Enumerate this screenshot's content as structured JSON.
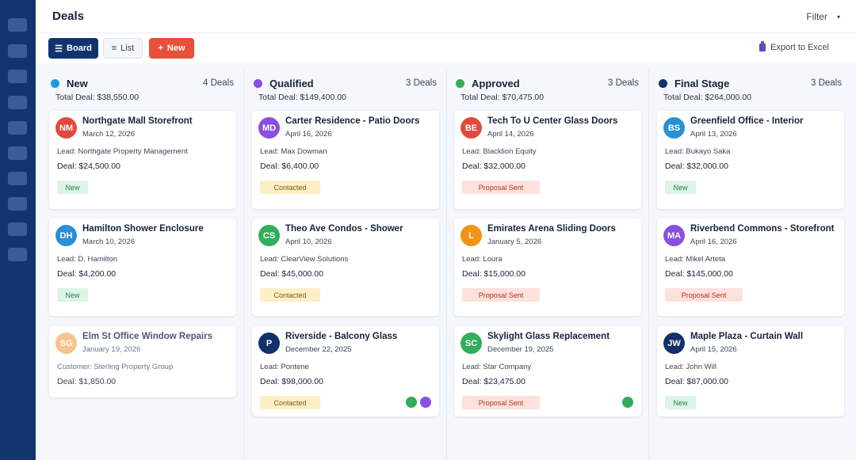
{
  "header": {
    "title": "Deals",
    "filter_label": "Filter",
    "filter_caret": "▾"
  },
  "toolbar": {
    "board_label": "Board",
    "board_icon": "☰",
    "list_label": "List",
    "list_icon": "≡",
    "new_label": "New",
    "new_icon": "+",
    "export_label": "Export to Excel"
  },
  "colors": {
    "sidebar": "#12346e",
    "accent": "#12346e",
    "new_button": "#e8503a"
  },
  "columns": [
    {
      "title": "New",
      "count": "4 Deals",
      "total": "Total Deal: $38,550.00",
      "dot_color": "#1e9be0",
      "cards": [
        {
          "initials": "NM",
          "avatar_color": "#e04a3d",
          "title": "Northgate Mall Storefront",
          "date": "March 12, 2026",
          "lead": "Lead: Northgate Property Management",
          "deal": "Deal: $24,500.00",
          "status": "New",
          "status_type": "new"
        },
        {
          "initials": "DH",
          "avatar_color": "#2a8fd6",
          "title": "Hamilton Shower Enclosure",
          "date": "March 10, 2026",
          "lead": "Lead: D. Hamilton",
          "deal": "Deal: $4,200.00",
          "status": "New",
          "status_type": "new"
        },
        {
          "initials": "SG",
          "avatar_color": "#f6c48e",
          "title": "Elm St Office Window Repairs",
          "date": "January 19, 2026",
          "lead": "Customer: Sterling Property Group",
          "deal": "Deal: $1,850.00",
          "status": "",
          "status_type": "",
          "faded": true
        }
      ]
    },
    {
      "title": "Qualified",
      "count": "3 Deals",
      "total": "Total Deal: $149,400.00",
      "dot_color": "#8a4fe0",
      "cards": [
        {
          "initials": "MD",
          "avatar_color": "#8a4fe0",
          "title": "Carter Residence - Patio Doors",
          "date": "April 16, 2026",
          "lead": "Lead: Max Dowman",
          "deal": "Deal: $6,400.00",
          "status": "Contacted",
          "status_type": "contacted"
        },
        {
          "initials": "CS",
          "avatar_color": "#2fae5b",
          "title": "Theo Ave Condos - Shower",
          "date": "April 10, 2026",
          "lead": "Lead: ClearView Solutions",
          "deal": "Deal: $45,000.00",
          "status": "Contacted",
          "status_type": "contacted"
        },
        {
          "initials": "P",
          "avatar_color": "#13306a",
          "title": "Riverside - Balcony Glass",
          "date": "December 22, 2025",
          "lead": "Lead: Pontene",
          "deal": "Deal: $98,000.00",
          "status": "Contacted",
          "status_type": "contacted",
          "dots": [
            "#2fae5b",
            "#8a4fe0"
          ]
        }
      ]
    },
    {
      "title": "Approved",
      "count": "3 Deals",
      "total": "Total Deal: $70,475.00",
      "dot_color": "#2fae5b",
      "cards": [
        {
          "initials": "BE",
          "avatar_color": "#e04a3d",
          "title": "Tech To U Center Glass Doors",
          "date": "April 14, 2026",
          "lead": "Lead: Blacklion Equity",
          "deal": "Deal: $32,000.00",
          "status": "Proposal Sent",
          "status_type": "proposal"
        },
        {
          "initials": "L",
          "avatar_color": "#f29312",
          "title": "Emirates Arena Sliding Doors",
          "date": "January 5, 2026",
          "lead": "Lead: Loura",
          "deal": "Deal: $15,000.00",
          "status": "Proposal Sent",
          "status_type": "proposal"
        },
        {
          "initials": "SC",
          "avatar_color": "#2fae5b",
          "title": "Skylight Glass Replacement",
          "date": "December 19, 2025",
          "lead": "Lead: Star Company",
          "deal": "Deal: $23,475.00",
          "status": "Proposal Sent",
          "status_type": "proposal",
          "dots": [
            "#2fae5b"
          ]
        }
      ]
    },
    {
      "title": "Final Stage",
      "count": "3 Deals",
      "total": "Total Deal: $264,000.00",
      "dot_color": "#13306a",
      "cards": [
        {
          "initials": "BS",
          "avatar_color": "#2a8fd6",
          "title": "Greenfield Office - Interior",
          "date": "April 13, 2026",
          "lead": "Lead: Bukayo Saka",
          "deal": "Deal: $32,000.00",
          "status": "New",
          "status_type": "new"
        },
        {
          "initials": "MA",
          "avatar_color": "#8a4fe0",
          "title": "Riverbend Commons - Storefront",
          "date": "April 16, 2026",
          "lead": "Lead: Mikel Arteta",
          "deal": "Deal: $145,000.00",
          "status": "Proposal Sent",
          "status_type": "proposal"
        },
        {
          "initials": "JW",
          "avatar_color": "#13306a",
          "title": "Maple Plaza - Curtain Wall",
          "date": "April 15, 2026",
          "lead": "Lead: John Will",
          "deal": "Deal: $87,000.00",
          "status": "New",
          "status_type": "new"
        }
      ]
    }
  ]
}
